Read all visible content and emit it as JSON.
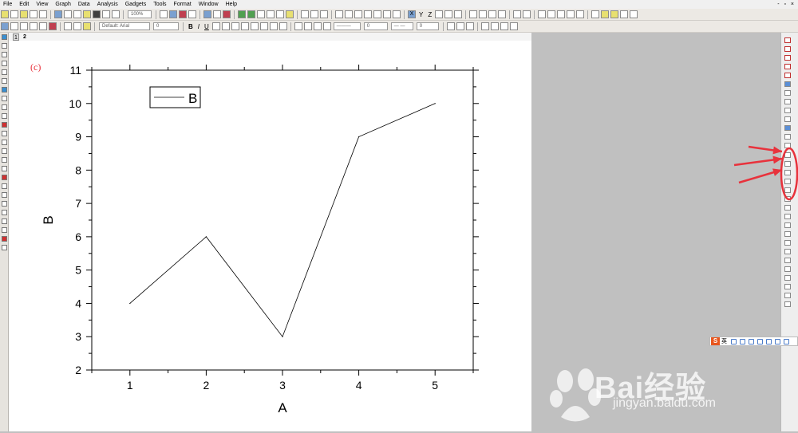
{
  "menu": [
    "File",
    "Edit",
    "View",
    "Graph",
    "Data",
    "Analysis",
    "Gadgets",
    "Tools",
    "Format",
    "Window",
    "Help"
  ],
  "window_controls": "- ▫ ×",
  "toolbar": {
    "zoom_value": "100%",
    "font_value": "Default: Arial",
    "font_size_value": "0",
    "bold_label": "B",
    "italic_label": "I",
    "underline_label": "U",
    "axis_x_label": "X",
    "axis_y_label": "Y",
    "axis_z_label": "Z",
    "line_width_value": "0",
    "fill_value": "0"
  },
  "tabs": [
    "1",
    "2"
  ],
  "graph": {
    "panel_label": "(c)",
    "legend_label": "B"
  },
  "chart_data": {
    "type": "line",
    "x": [
      1,
      2,
      3,
      4,
      5
    ],
    "series": [
      {
        "name": "B",
        "values": [
          4,
          6,
          3,
          9,
          10
        ]
      }
    ],
    "xlabel": "A",
    "ylabel": "B",
    "xlim": [
      0.5,
      5.5
    ],
    "ylim": [
      2,
      11
    ],
    "xticks": [
      1,
      2,
      3,
      4,
      5
    ],
    "yticks": [
      2,
      3,
      4,
      5,
      6,
      7,
      8,
      9,
      10,
      11
    ],
    "grid": false,
    "legend_position": "top-left"
  },
  "ime": {
    "lang_label": "英",
    "logo": "S"
  },
  "watermark": {
    "brand": "Bai经验",
    "url": "jingyan.baidu.com"
  },
  "annotation_color": "#e8323c"
}
